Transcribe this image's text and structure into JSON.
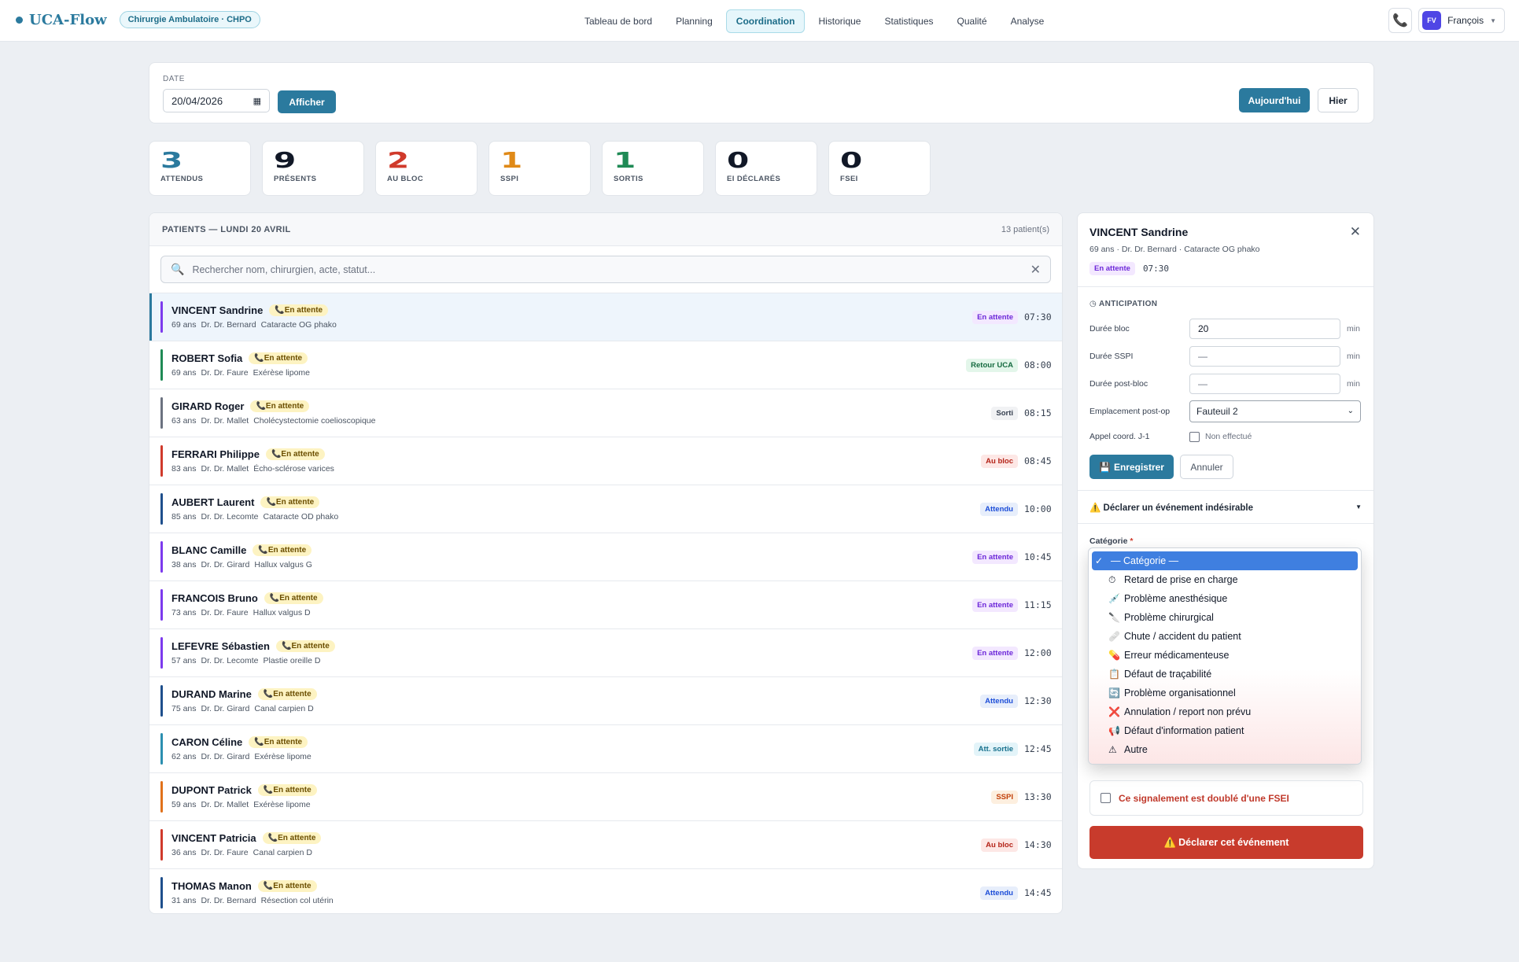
{
  "brand": {
    "name": "UCA-Flow",
    "chip": "Chirurgie Ambulatoire · CHPO"
  },
  "nav": [
    {
      "label": "Tableau de bord",
      "active": false
    },
    {
      "label": "Planning",
      "active": false
    },
    {
      "label": "Coordination",
      "active": true
    },
    {
      "label": "Historique",
      "active": false
    },
    {
      "label": "Statistiques",
      "active": false
    },
    {
      "label": "Qualité",
      "active": false
    },
    {
      "label": "Analyse",
      "active": false
    }
  ],
  "user": {
    "initials": "FV",
    "name": "François",
    "avatar_color": "#4f46e5"
  },
  "datebar": {
    "label": "DATE",
    "value": "20/04/2026",
    "show_label": "Afficher",
    "today_label": "Aujourd'hui",
    "yesterday_label": "Hier"
  },
  "stats": [
    {
      "value": "3",
      "label": "ATTENDUS",
      "color": "#2b7a9e"
    },
    {
      "value": "9",
      "label": "PRÉSENTS",
      "color": "#111827"
    },
    {
      "value": "2",
      "label": "AU BLOC",
      "color": "#d03a2b"
    },
    {
      "value": "1",
      "label": "SSPI",
      "color": "#e08a18"
    },
    {
      "value": "1",
      "label": "SORTIS",
      "color": "#1f8a55"
    },
    {
      "value": "0",
      "label": "EI DÉCLARÉS",
      "color": "#111827"
    },
    {
      "value": "0",
      "label": "FSEI",
      "color": "#111827"
    }
  ],
  "patients": {
    "title": "PATIENTS — LUNDI 20 AVRIL",
    "count": "13 patient(s)",
    "search_placeholder": "Rechercher nom, chirurgien, acte, statut...",
    "call_badge": "En attente",
    "rows": [
      {
        "name": "VINCENT Sandrine",
        "age": "69 ans",
        "surgeon": "Dr. Dr. Bernard",
        "act": "Cataracte OG phako",
        "status": "En attente",
        "time": "07:30",
        "bar": "#7c3aed",
        "st_bg": "#f3e8ff",
        "st_fg": "#6d28d9",
        "selected": true
      },
      {
        "name": "ROBERT Sofia",
        "age": "69 ans",
        "surgeon": "Dr. Dr. Faure",
        "act": "Exérèse lipome",
        "status": "Retour UCA",
        "time": "08:00",
        "bar": "#1f8a55",
        "st_bg": "#e3f6ea",
        "st_fg": "#166b40"
      },
      {
        "name": "GIRARD Roger",
        "age": "63 ans",
        "surgeon": "Dr. Dr. Mallet",
        "act": "Cholécystectomie coelioscopique",
        "status": "Sorti",
        "time": "08:15",
        "bar": "#6b7280",
        "st_bg": "#f1f2f4",
        "st_fg": "#374151"
      },
      {
        "name": "FERRARI Philippe",
        "age": "83 ans",
        "surgeon": "Dr. Dr. Mallet",
        "act": "Écho-sclérose varices",
        "status": "Au bloc",
        "time": "08:45",
        "bar": "#d03a2b",
        "st_bg": "#fde7e5",
        "st_fg": "#b42318"
      },
      {
        "name": "AUBERT Laurent",
        "age": "85 ans",
        "surgeon": "Dr. Dr. Lecomte",
        "act": "Cataracte OD phako",
        "status": "Attendu",
        "time": "10:00",
        "bar": "#1e4f8c",
        "st_bg": "#e7eefb",
        "st_fg": "#1d4ed8"
      },
      {
        "name": "BLANC Camille",
        "age": "38 ans",
        "surgeon": "Dr. Dr. Girard",
        "act": "Hallux valgus G",
        "status": "En attente",
        "time": "10:45",
        "bar": "#7c3aed",
        "st_bg": "#f3e8ff",
        "st_fg": "#6d28d9"
      },
      {
        "name": "FRANCOIS Bruno",
        "age": "73 ans",
        "surgeon": "Dr. Dr. Faure",
        "act": "Hallux valgus D",
        "status": "En attente",
        "time": "11:15",
        "bar": "#7c3aed",
        "st_bg": "#f3e8ff",
        "st_fg": "#6d28d9"
      },
      {
        "name": "LEFEVRE Sébastien",
        "age": "57 ans",
        "surgeon": "Dr. Dr. Lecomte",
        "act": "Plastie oreille D",
        "status": "En attente",
        "time": "12:00",
        "bar": "#7c3aed",
        "st_bg": "#f3e8ff",
        "st_fg": "#6d28d9"
      },
      {
        "name": "DURAND Marine",
        "age": "75 ans",
        "surgeon": "Dr. Dr. Girard",
        "act": "Canal carpien D",
        "status": "Attendu",
        "time": "12:30",
        "bar": "#1e4f8c",
        "st_bg": "#e7eefb",
        "st_fg": "#1d4ed8"
      },
      {
        "name": "CARON Céline",
        "age": "62 ans",
        "surgeon": "Dr. Dr. Girard",
        "act": "Exérèse lipome",
        "status": "Att. sortie",
        "time": "12:45",
        "bar": "#2b8fb0",
        "st_bg": "#e3f4f9",
        "st_fg": "#16708d"
      },
      {
        "name": "DUPONT Patrick",
        "age": "59 ans",
        "surgeon": "Dr. Dr. Mallet",
        "act": "Exérèse lipome",
        "status": "SSPI",
        "time": "13:30",
        "bar": "#e0711b",
        "st_bg": "#fdefdf",
        "st_fg": "#c2410c"
      },
      {
        "name": "VINCENT Patricia",
        "age": "36 ans",
        "surgeon": "Dr. Dr. Faure",
        "act": "Canal carpien D",
        "status": "Au bloc",
        "time": "14:30",
        "bar": "#d03a2b",
        "st_bg": "#fde7e5",
        "st_fg": "#b42318"
      },
      {
        "name": "THOMAS Manon",
        "age": "31 ans",
        "surgeon": "Dr. Dr. Bernard",
        "act": "Résection col utérin",
        "status": "Attendu",
        "time": "14:45",
        "bar": "#1e4f8c",
        "st_bg": "#e7eefb",
        "st_fg": "#1d4ed8"
      }
    ]
  },
  "detail": {
    "name": "VINCENT Sandrine",
    "sub": "69 ans · Dr. Dr. Bernard · Cataracte OG phako",
    "status": "En attente",
    "time": "07:30",
    "anticipation_title": "ANTICIPATION",
    "fields": {
      "bloc_label": "Durée bloc",
      "bloc_value": "20",
      "sspi_label": "Durée SSPI",
      "sspi_value": "—",
      "post_label": "Durée post-bloc",
      "post_value": "—",
      "unit": "min",
      "location_label": "Emplacement post-op",
      "location_value": "Fauteuil 2",
      "call_label": "Appel coord. J-1",
      "call_value": "Non effectué"
    },
    "save_label": "Enregistrer",
    "cancel_label": "Annuler",
    "ei_title": "Déclarer un événement indésirable",
    "category_label": "Catégorie",
    "category_required": "*",
    "categories": [
      {
        "icon": "✓",
        "label": "— Catégorie —",
        "selected": true
      },
      {
        "icon": "⏱",
        "label": "Retard de prise en charge"
      },
      {
        "icon": "💉",
        "label": "Problème anesthésique"
      },
      {
        "icon": "🔪",
        "label": "Problème chirurgical"
      },
      {
        "icon": "🩹",
        "label": "Chute / accident du patient"
      },
      {
        "icon": "💊",
        "label": "Erreur médicamenteuse"
      },
      {
        "icon": "📋",
        "label": "Défaut de traçabilité"
      },
      {
        "icon": "🔄",
        "label": "Problème organisationnel"
      },
      {
        "icon": "❌",
        "label": "Annulation / report non prévu"
      },
      {
        "icon": "📢",
        "label": "Défaut d'information patient"
      },
      {
        "icon": "⚠",
        "label": "Autre"
      }
    ],
    "fsei_label": "Ce signalement est doublé d'une FSEI",
    "declare_label": "Déclarer cet événement"
  }
}
